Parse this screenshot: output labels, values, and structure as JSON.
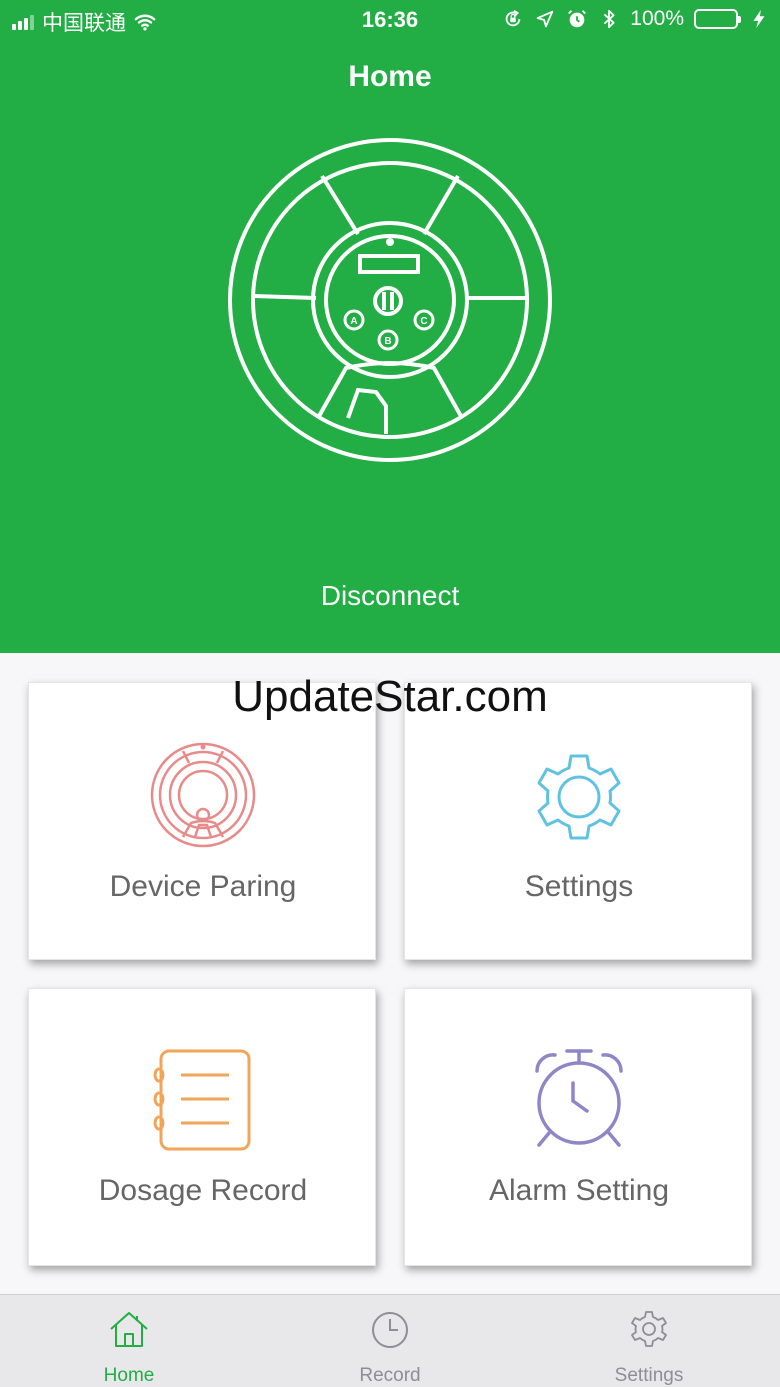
{
  "status_bar": {
    "carrier": "中国联通",
    "time": "16:36",
    "battery": "100%"
  },
  "header": {
    "title": "Home",
    "disconnect_label": "Disconnect"
  },
  "watermark": "UpdateStar.com",
  "cards": [
    {
      "label": "Device Paring",
      "icon": "pill-box-icon",
      "color": "#e98a8a"
    },
    {
      "label": "Settings",
      "icon": "gear-icon",
      "color": "#5fc3e0"
    },
    {
      "label": "Dosage Record",
      "icon": "notebook-icon",
      "color": "#f0a55a"
    },
    {
      "label": "Alarm Setting",
      "icon": "alarm-clock-icon",
      "color": "#8f86c8"
    }
  ],
  "tab_bar": {
    "tabs": [
      {
        "label": "Home",
        "icon": "home-icon",
        "active": true
      },
      {
        "label": "Record",
        "icon": "clock-icon",
        "active": false
      },
      {
        "label": "Settings",
        "icon": "gear-icon",
        "active": false
      }
    ]
  },
  "colors": {
    "brand": "#22ad45",
    "tab_inactive": "#8e8e93"
  }
}
